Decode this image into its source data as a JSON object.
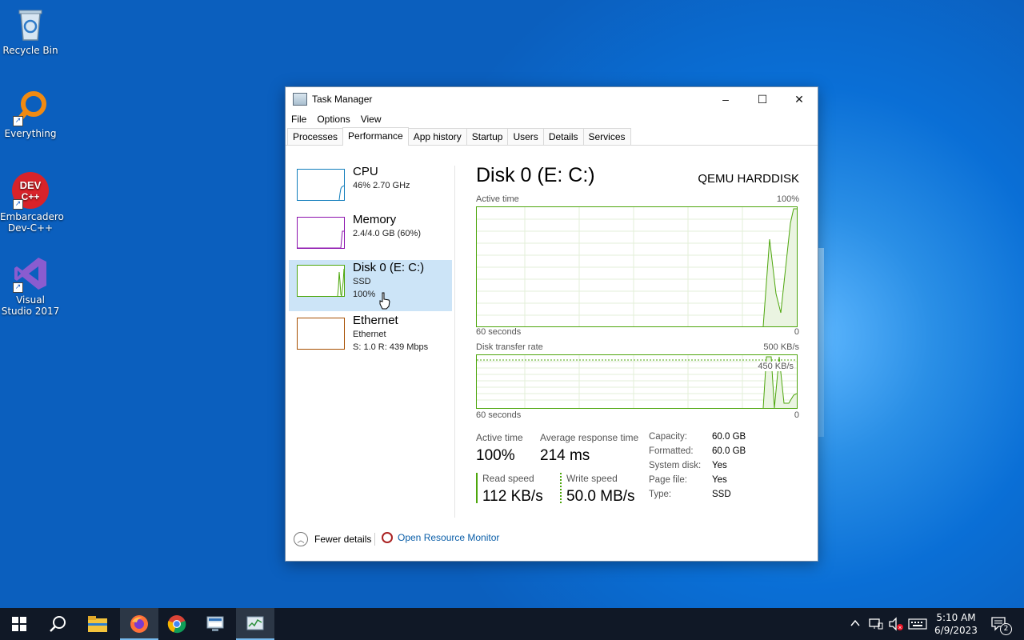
{
  "desktop": {
    "icons": [
      {
        "label": "Recycle Bin",
        "icon": "recycle-bin-icon"
      },
      {
        "label": "Everything",
        "icon": "everything-search-icon"
      },
      {
        "label": "Embarcadero Dev-C++",
        "icon": "devcpp-icon",
        "icon_text": "DEV C++"
      },
      {
        "label": "Visual Studio 2017",
        "icon": "visual-studio-icon"
      }
    ]
  },
  "window": {
    "title": "Task Manager",
    "controls": {
      "minimize": "–",
      "maximize": "☐",
      "close": "✕"
    },
    "menu": [
      "File",
      "Options",
      "View"
    ],
    "tabs": [
      "Processes",
      "Performance",
      "App history",
      "Startup",
      "Users",
      "Details",
      "Services"
    ],
    "active_tab": "Performance"
  },
  "sidebar": {
    "items": [
      {
        "name": "CPU",
        "line1": "46%  2.70 GHz",
        "line2": "",
        "color": "#117dbb"
      },
      {
        "name": "Memory",
        "line1": "2.4/4.0 GB (60%)",
        "line2": "",
        "color": "#8b12ae"
      },
      {
        "name": "Disk 0 (E: C:)",
        "line1": "SSD",
        "line2": "100%",
        "color": "#4da60c",
        "selected": true
      },
      {
        "name": "Ethernet",
        "line1": "Ethernet",
        "line2": "S: 1.0  R: 439 Mbps",
        "color": "#a74f01"
      }
    ]
  },
  "detail": {
    "title": "Disk 0 (E: C:)",
    "model": "QEMU HARDDISK",
    "active_time_graph": {
      "label": "Active time",
      "max_label": "100%",
      "x_label": "60 seconds",
      "min_label": "0"
    },
    "transfer_graph": {
      "label": "Disk transfer rate",
      "max_label": "500 KB/s",
      "inner_label": "450 KB/s",
      "x_label": "60 seconds",
      "min_label": "0"
    },
    "stats": {
      "active_time_label": "Active time",
      "active_time_value": "100%",
      "avg_resp_label": "Average response time",
      "avg_resp_value": "214 ms",
      "read_label": "Read speed",
      "read_value": "112 KB/s",
      "write_label": "Write speed",
      "write_value": "50.0 MB/s"
    },
    "properties": [
      {
        "key": "Capacity:",
        "value": "60.0 GB"
      },
      {
        "key": "Formatted:",
        "value": "60.0 GB"
      },
      {
        "key": "System disk:",
        "value": "Yes"
      },
      {
        "key": "Page file:",
        "value": "Yes"
      },
      {
        "key": "Type:",
        "value": "SSD"
      }
    ]
  },
  "footer": {
    "fewer_details": "Fewer details",
    "resource_monitor": "Open Resource Monitor"
  },
  "taskbar": {
    "apps": [
      "start-icon",
      "search-icon",
      "file-explorer-icon",
      "firefox-icon",
      "chrome-icon",
      "network-app-icon",
      "task-manager-icon"
    ],
    "clock_time": "5:10 AM",
    "clock_date": "6/9/2023",
    "notification_count": "2"
  },
  "colors": {
    "disk_green": "#4da60c",
    "accent_blue": "#0a5ea8",
    "selection": "#cce4f7"
  }
}
